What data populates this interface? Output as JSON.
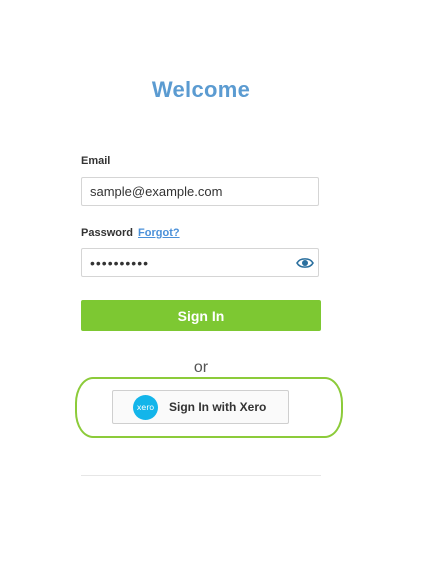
{
  "header": {
    "title": "Welcome"
  },
  "form": {
    "email_label": "Email",
    "email_value": "sample@example.com",
    "password_label": "Password",
    "forgot_link": "Forgot?",
    "password_value": "••••••••••",
    "signin_label": "Sign In",
    "or_text": "or"
  },
  "xero": {
    "logo_text": "xero",
    "button_label": "Sign In with Xero"
  },
  "icons": {
    "password_toggle": "eye-icon",
    "xero_logo": "xero-logo-icon"
  },
  "colors": {
    "title": "#5b9bd1",
    "primary_button": "#7dc832",
    "link": "#4a90d9",
    "highlight_outline": "#8ccb3a",
    "xero_brand": "#13b5ea"
  }
}
